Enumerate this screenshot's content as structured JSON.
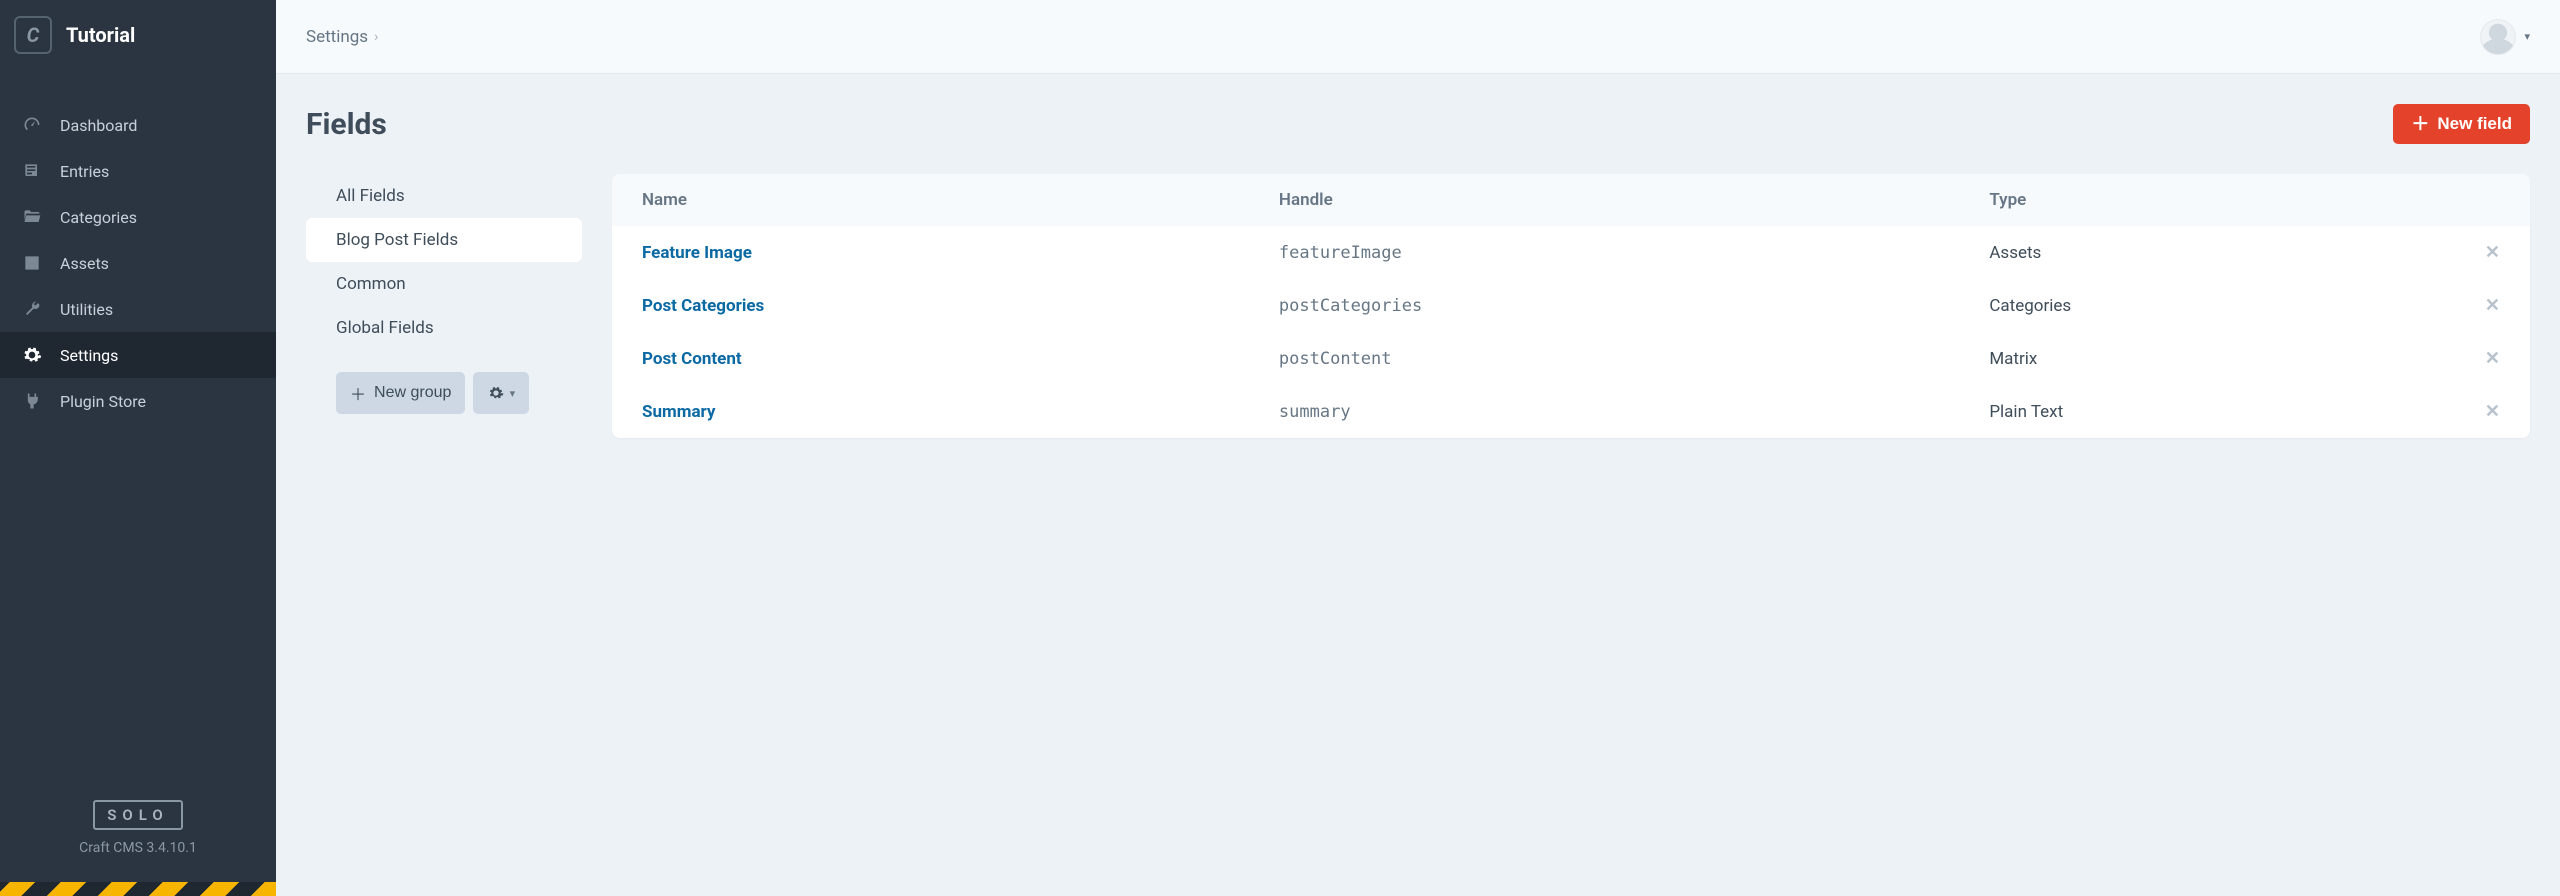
{
  "header": {
    "logo_letter": "C",
    "site_name": "Tutorial"
  },
  "nav": {
    "items": [
      {
        "key": "dashboard",
        "label": "Dashboard"
      },
      {
        "key": "entries",
        "label": "Entries"
      },
      {
        "key": "categories",
        "label": "Categories"
      },
      {
        "key": "assets",
        "label": "Assets"
      },
      {
        "key": "utilities",
        "label": "Utilities"
      },
      {
        "key": "settings",
        "label": "Settings"
      },
      {
        "key": "plugin-store",
        "label": "Plugin Store"
      }
    ],
    "active": "settings"
  },
  "edition_badge": "SOLO",
  "version_line": "Craft CMS 3.4.10.1",
  "breadcrumb": {
    "root": "Settings"
  },
  "page_title": "Fields",
  "new_field_button": "New field",
  "groups": {
    "items": [
      {
        "label": "All Fields"
      },
      {
        "label": "Blog Post Fields"
      },
      {
        "label": "Common"
      },
      {
        "label": "Global Fields"
      }
    ],
    "selected_index": 1,
    "new_group_button": "New group"
  },
  "table": {
    "columns": {
      "name": "Name",
      "handle": "Handle",
      "type": "Type"
    },
    "rows": [
      {
        "name": "Feature Image",
        "handle": "featureImage",
        "type": "Assets"
      },
      {
        "name": "Post Categories",
        "handle": "postCategories",
        "type": "Categories"
      },
      {
        "name": "Post Content",
        "handle": "postContent",
        "type": "Matrix"
      },
      {
        "name": "Summary",
        "handle": "summary",
        "type": "Plain Text"
      }
    ]
  }
}
